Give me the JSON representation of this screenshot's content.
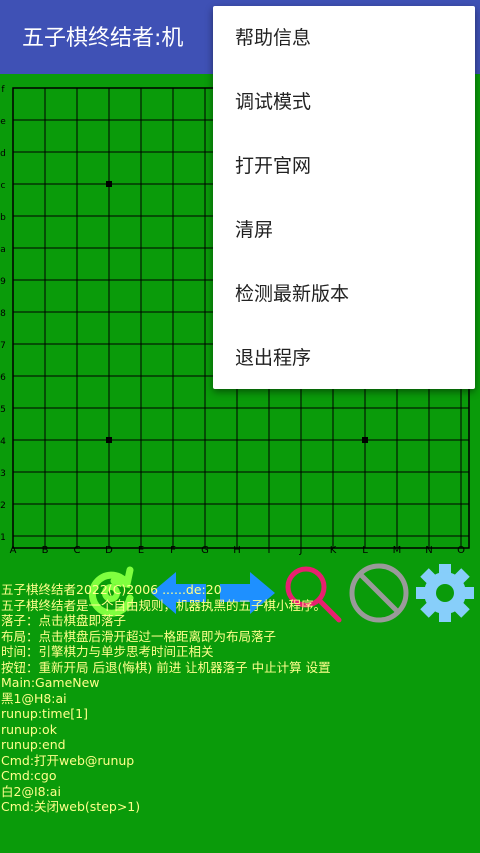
{
  "app": {
    "title": "五子棋终结者:机"
  },
  "board": {
    "col_labels": [
      "A",
      "B",
      "C",
      "D",
      "E",
      "F",
      "G",
      "H",
      "I",
      "J",
      "K",
      "L",
      "M",
      "N",
      "O"
    ],
    "row_labels": [
      "1",
      "2",
      "3",
      "4",
      "5",
      "6",
      "7",
      "8",
      "9",
      "a",
      "b",
      "c",
      "d",
      "e",
      "f"
    ],
    "star_points": [
      "D4",
      "L4",
      "D12"
    ],
    "colors": {
      "background": "#0a9b0a",
      "grid": "#000000"
    }
  },
  "toolbar": {
    "buttons": [
      {
        "name": "restart-button",
        "icon": "refresh-icon",
        "color": "#7fff3f"
      },
      {
        "name": "undo-button",
        "icon": "arrow-left-icon",
        "color": "#1e90ff"
      },
      {
        "name": "forward-button",
        "icon": "arrow-right-icon",
        "color": "#1e90ff"
      },
      {
        "name": "ai-move-button",
        "icon": "search-icon",
        "color": "#e8206f"
      },
      {
        "name": "stop-button",
        "icon": "prohibit-icon",
        "color": "#9a9a9a"
      },
      {
        "name": "settings-button",
        "icon": "gear-icon",
        "color": "#87cefa"
      }
    ]
  },
  "log": {
    "lines": [
      "五子棋终结者2022(C)2006 ......de:20",
      "五子棋终结者是一个自由规则，机器执黑的五子棋小程序。",
      "落子：点击棋盘即落子",
      "布局：点击棋盘后滑开超过一格距离即为布局落子",
      "时间：引擎棋力与单步思考时间正相关",
      "按钮：重新开局 后退(悔棋) 前进 让机器落子 中止计算 设置",
      "Main:GameNew",
      "黑1@H8:ai",
      "runup:time[1]",
      "runup:ok",
      "runup:end",
      "Cmd:打开web@runup",
      "Cmd:cgo",
      "白2@I8:ai",
      "Cmd:关闭web(step>1)"
    ]
  },
  "menu": {
    "items": [
      {
        "label": "帮助信息"
      },
      {
        "label": "调试模式"
      },
      {
        "label": "打开官网"
      },
      {
        "label": "清屏"
      },
      {
        "label": "检测最新版本"
      },
      {
        "label": "退出程序"
      }
    ]
  }
}
